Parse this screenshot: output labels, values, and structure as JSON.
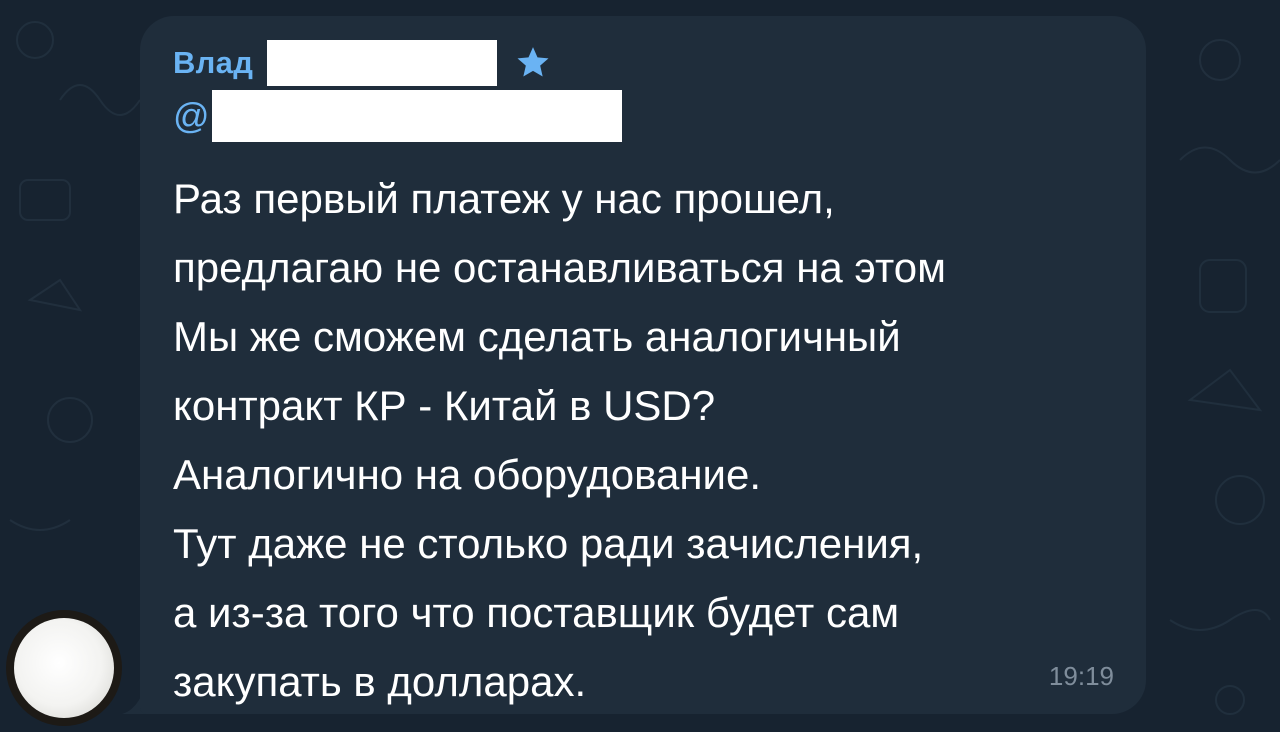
{
  "message": {
    "sender_name": "Влад",
    "username_prefix": "@",
    "lines": [
      "Раз первый платеж у нас прошел,",
      "предлагаю не останавливаться на этом",
      "Мы же сможем сделать аналогичный",
      "контракт КР - Китай в USD?",
      "Аналогично на оборудование.",
      "Тут даже не столько ради зачисления,",
      "а из-за того что поставщик будет сам",
      "закупать в долларах."
    ],
    "time": "19:19"
  },
  "icons": {
    "sender_badge": "star-icon",
    "avatar": "avatar"
  },
  "colors": {
    "background": "#172330",
    "bubble": "#1f2d3b",
    "accent": "#6ab3f3",
    "text": "#ffffff",
    "timestamp": "#7f8d9b"
  }
}
